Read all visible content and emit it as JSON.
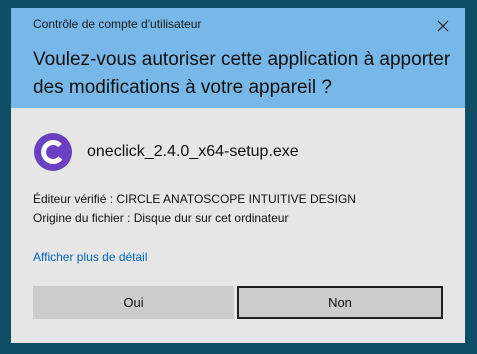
{
  "dialog": {
    "caption": "Contrôle de compte d'utilisateur",
    "question": "Voulez-vous autoriser cette application à apporter des modifications à votre appareil ?",
    "close_icon": "close-icon"
  },
  "app": {
    "name": "oneclick_2.4.0_x64-setup.exe",
    "icon": "oneclick-app-icon",
    "icon_color": "#6b3fc2"
  },
  "info": {
    "publisher": "Éditeur vérifié : CIRCLE ANATOSCOPE INTUITIVE DESIGN",
    "origin": "Origine du fichier : Disque dur sur cet ordinateur"
  },
  "details_link": "Afficher plus de détail",
  "buttons": {
    "yes": "Oui",
    "no": "Non"
  },
  "colors": {
    "header": "#77b8e8",
    "body": "#e6e6e6",
    "link": "#0067c0",
    "backdrop": "#0f4f66"
  }
}
